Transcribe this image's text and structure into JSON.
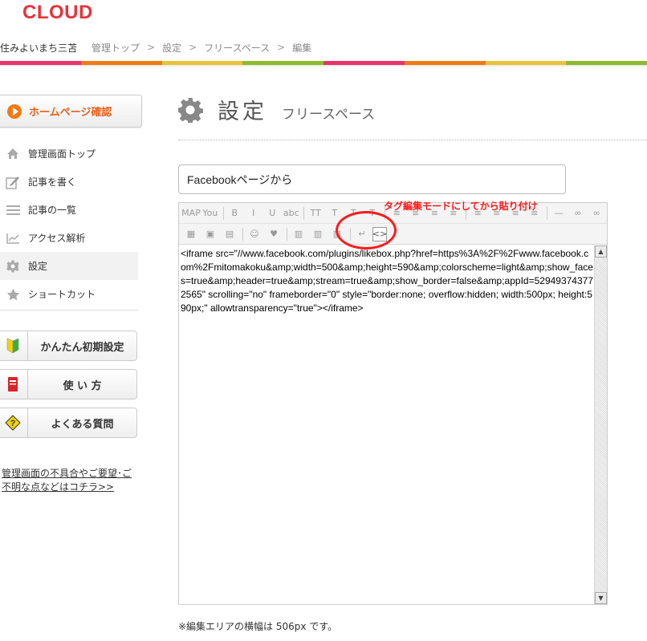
{
  "header": {
    "logo": "CLOUD",
    "site_name": "住みよいまち三苫",
    "breadcrumbs": [
      "管理トップ",
      "設定",
      "フリースペース",
      "編集"
    ],
    "separator": ">",
    "colorbar_colors": [
      "#e8336a",
      "#f07b13",
      "#e8c33a",
      "#8dbb2a",
      "#e8336a",
      "#f07b13",
      "#e8c33a",
      "#8dbb2a"
    ]
  },
  "sidebar": {
    "homepage_button": "ホームページ確認",
    "items": [
      {
        "label": "管理画面トップ",
        "icon": "home-icon"
      },
      {
        "label": "記事を書く",
        "icon": "edit-icon"
      },
      {
        "label": "記事の一覧",
        "icon": "list-icon"
      },
      {
        "label": "アクセス解析",
        "icon": "chart-icon"
      },
      {
        "label": "設定",
        "icon": "gear-icon"
      },
      {
        "label": "ショートカット",
        "icon": "star-icon"
      }
    ],
    "help_buttons": [
      {
        "label": "かんたん初期設定",
        "icon": "beginner-mark-icon"
      },
      {
        "label": "使 い 方",
        "icon": "book-icon"
      },
      {
        "label": "よくある質問",
        "icon": "question-icon"
      }
    ],
    "support_link": "管理画面の不具合やご要望･ご不明な点などはコチラ>>"
  },
  "main": {
    "title": "設定",
    "subtitle": "フリースペース",
    "title_field_value": "Facebookページから",
    "editor_content": "<iframe src=\"//www.facebook.com/plugins/likebox.php?href=https%3A%2F%2Fwww.facebook.com%2Fmitomakoku&amp;width=500&amp;height=590&amp;colorscheme=light&amp;show_faces=true&amp;header=true&amp;stream=true&amp;show_border=false&amp;appId=529493743772565\" scrolling=\"no\" frameborder=\"0\" style=\"border:none; overflow:hidden; width:500px; height:590px;\" allowtransparency=\"true\"></iframe>",
    "annotation": "タグ編集モードにしてから貼り付け",
    "width_note": "※編集エリアの横幅は 506px です。"
  },
  "toolbar": {
    "row1": [
      "MAP",
      "You",
      "B",
      "I",
      "U",
      "abc",
      "TT",
      "T",
      "T",
      "T",
      "≡",
      "≡",
      "≡",
      "≡",
      "≡",
      "≡",
      "≡",
      "≡",
      "—",
      "∞",
      "∞"
    ],
    "row2": [
      "▦",
      "▣",
      "▤",
      "☺",
      "♥",
      "▥",
      "▥",
      "▥",
      "↵",
      "<>"
    ]
  }
}
